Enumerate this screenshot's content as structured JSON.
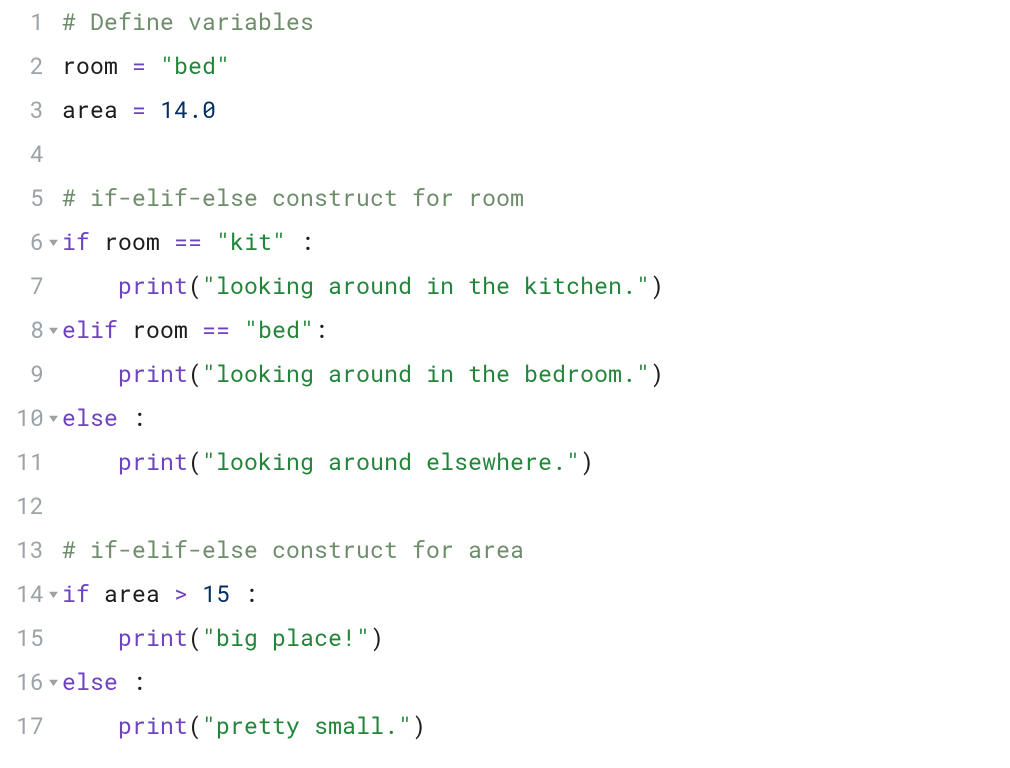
{
  "editor": {
    "language": "python",
    "lines": [
      {
        "num": "1",
        "fold": false,
        "tokens": [
          {
            "t": "# Define variables",
            "c": "comment"
          }
        ]
      },
      {
        "num": "2",
        "fold": false,
        "tokens": [
          {
            "t": "room",
            "c": "default"
          },
          {
            "t": " ",
            "c": "default"
          },
          {
            "t": "=",
            "c": "operator"
          },
          {
            "t": " ",
            "c": "default"
          },
          {
            "t": "\"bed\"",
            "c": "string"
          }
        ]
      },
      {
        "num": "3",
        "fold": false,
        "tokens": [
          {
            "t": "area",
            "c": "default"
          },
          {
            "t": " ",
            "c": "default"
          },
          {
            "t": "=",
            "c": "operator"
          },
          {
            "t": " ",
            "c": "default"
          },
          {
            "t": "14.0",
            "c": "number"
          }
        ]
      },
      {
        "num": "4",
        "fold": false,
        "tokens": []
      },
      {
        "num": "5",
        "fold": false,
        "tokens": [
          {
            "t": "# if-elif-else construct for room",
            "c": "comment"
          }
        ]
      },
      {
        "num": "6",
        "fold": true,
        "tokens": [
          {
            "t": "if",
            "c": "keyword"
          },
          {
            "t": " ",
            "c": "default"
          },
          {
            "t": "room",
            "c": "default"
          },
          {
            "t": " ",
            "c": "default"
          },
          {
            "t": "==",
            "c": "operator"
          },
          {
            "t": " ",
            "c": "default"
          },
          {
            "t": "\"kit\"",
            "c": "string"
          },
          {
            "t": " ",
            "c": "default"
          },
          {
            "t": ":",
            "c": "colon"
          }
        ]
      },
      {
        "num": "7",
        "fold": false,
        "tokens": [
          {
            "t": "    ",
            "c": "default"
          },
          {
            "t": "print",
            "c": "builtin"
          },
          {
            "t": "(",
            "c": "paren"
          },
          {
            "t": "\"looking around in the kitchen.\"",
            "c": "string"
          },
          {
            "t": ")",
            "c": "paren"
          }
        ]
      },
      {
        "num": "8",
        "fold": true,
        "tokens": [
          {
            "t": "elif",
            "c": "keyword"
          },
          {
            "t": " ",
            "c": "default"
          },
          {
            "t": "room",
            "c": "default"
          },
          {
            "t": " ",
            "c": "default"
          },
          {
            "t": "==",
            "c": "operator"
          },
          {
            "t": " ",
            "c": "default"
          },
          {
            "t": "\"bed\"",
            "c": "string"
          },
          {
            "t": ":",
            "c": "colon"
          }
        ]
      },
      {
        "num": "9",
        "fold": false,
        "tokens": [
          {
            "t": "    ",
            "c": "default"
          },
          {
            "t": "print",
            "c": "builtin"
          },
          {
            "t": "(",
            "c": "paren"
          },
          {
            "t": "\"looking around in the bedroom.\"",
            "c": "string"
          },
          {
            "t": ")",
            "c": "paren"
          }
        ]
      },
      {
        "num": "10",
        "fold": true,
        "tokens": [
          {
            "t": "else",
            "c": "keyword"
          },
          {
            "t": " ",
            "c": "default"
          },
          {
            "t": ":",
            "c": "colon"
          }
        ]
      },
      {
        "num": "11",
        "fold": false,
        "tokens": [
          {
            "t": "    ",
            "c": "default"
          },
          {
            "t": "print",
            "c": "builtin"
          },
          {
            "t": "(",
            "c": "paren"
          },
          {
            "t": "\"looking around elsewhere.\"",
            "c": "string"
          },
          {
            "t": ")",
            "c": "paren"
          }
        ]
      },
      {
        "num": "12",
        "fold": false,
        "tokens": []
      },
      {
        "num": "13",
        "fold": false,
        "tokens": [
          {
            "t": "# if-elif-else construct for area",
            "c": "comment"
          }
        ]
      },
      {
        "num": "14",
        "fold": true,
        "tokens": [
          {
            "t": "if",
            "c": "keyword"
          },
          {
            "t": " ",
            "c": "default"
          },
          {
            "t": "area",
            "c": "default"
          },
          {
            "t": " ",
            "c": "default"
          },
          {
            "t": ">",
            "c": "operator"
          },
          {
            "t": " ",
            "c": "default"
          },
          {
            "t": "15",
            "c": "number"
          },
          {
            "t": " ",
            "c": "default"
          },
          {
            "t": ":",
            "c": "colon"
          }
        ]
      },
      {
        "num": "15",
        "fold": false,
        "tokens": [
          {
            "t": "    ",
            "c": "default"
          },
          {
            "t": "print",
            "c": "builtin"
          },
          {
            "t": "(",
            "c": "paren"
          },
          {
            "t": "\"big place!\"",
            "c": "string"
          },
          {
            "t": ")",
            "c": "paren"
          }
        ]
      },
      {
        "num": "16",
        "fold": true,
        "tokens": [
          {
            "t": "else",
            "c": "keyword"
          },
          {
            "t": " ",
            "c": "default"
          },
          {
            "t": ":",
            "c": "colon"
          }
        ]
      },
      {
        "num": "17",
        "fold": false,
        "tokens": [
          {
            "t": "    ",
            "c": "default"
          },
          {
            "t": "print",
            "c": "builtin"
          },
          {
            "t": "(",
            "c": "paren"
          },
          {
            "t": "\"pretty small.\"",
            "c": "string"
          },
          {
            "t": ")",
            "c": "paren"
          }
        ]
      }
    ]
  }
}
